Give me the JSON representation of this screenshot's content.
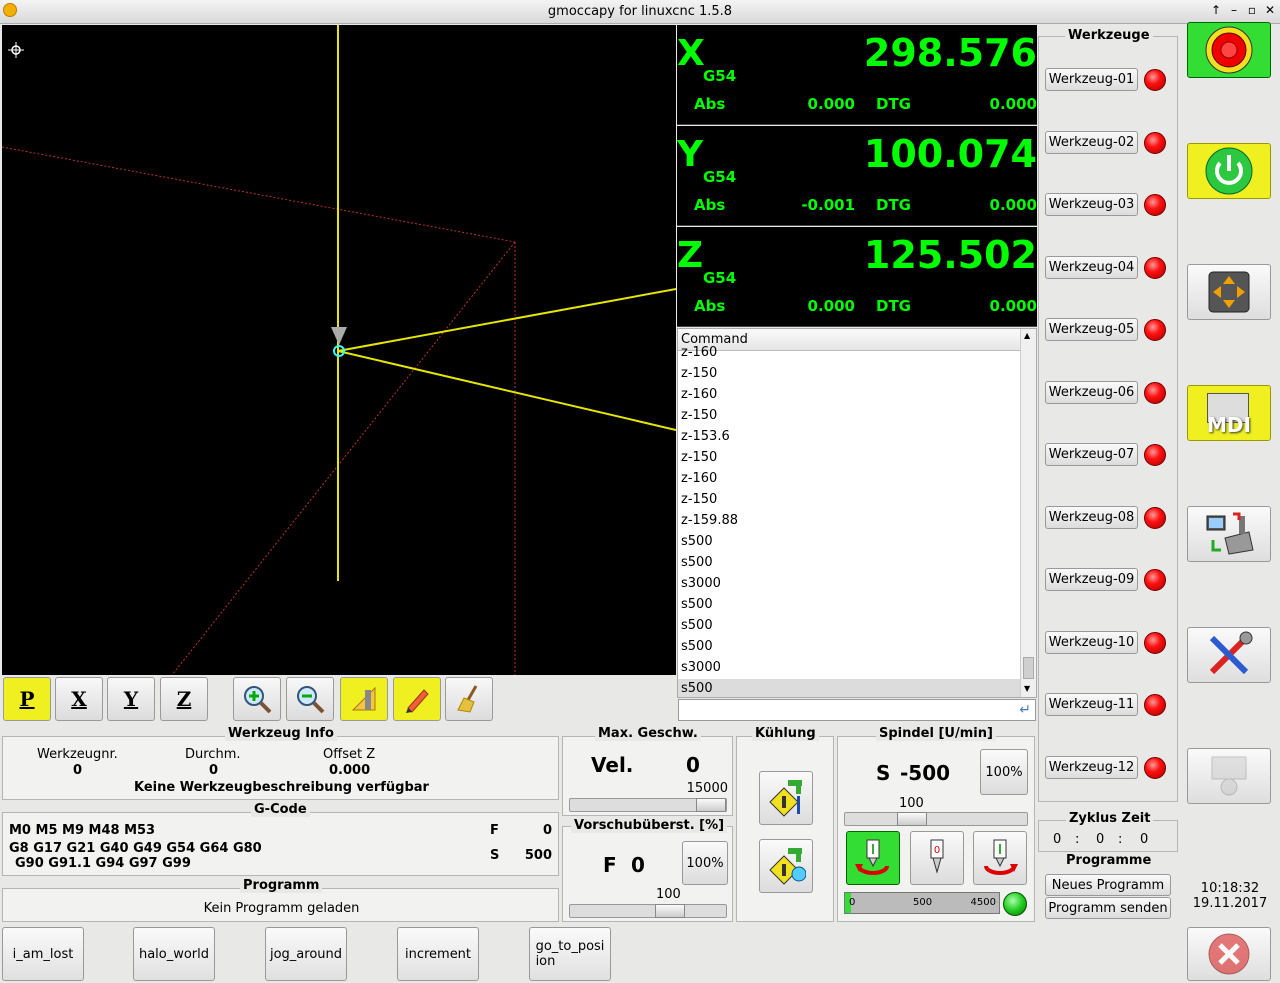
{
  "window": {
    "title": "gmoccapy for linuxcnc  1.5.8"
  },
  "dro": [
    {
      "axis": "X",
      "coord": "G54",
      "value": "298.576",
      "abs_label": "Abs",
      "abs": "0.000",
      "dtg_label": "DTG",
      "dtg": "0.000"
    },
    {
      "axis": "Y",
      "coord": "G54",
      "value": "100.074",
      "abs_label": "Abs",
      "abs": "-0.001",
      "dtg_label": "DTG",
      "dtg": "0.000"
    },
    {
      "axis": "Z",
      "coord": "G54",
      "value": "125.502",
      "abs_label": "Abs",
      "abs": "0.000",
      "dtg_label": "DTG",
      "dtg": "0.000"
    }
  ],
  "command_list": {
    "header": "Command",
    "rows": [
      "z-160",
      "z-150",
      "z-160",
      "z-150",
      "z-153.6",
      "z-150",
      "z-160",
      "z-150",
      "z-159.88",
      "s500",
      "s500",
      "s3000",
      "s500",
      "s500",
      "s500",
      "s3000",
      "s500"
    ]
  },
  "view_toolbar": {
    "p": "P",
    "x": "X",
    "y": "Y",
    "z": "Z"
  },
  "tool_info": {
    "title": "Werkzeug Info",
    "nr_label": "Werkzeugnr.",
    "nr": "0",
    "diam_label": "Durchm.",
    "diam": "0",
    "offset_label": "Offset Z",
    "offset": "0.000",
    "desc": "Keine Werkzeugbeschreibung verfügbar"
  },
  "gcode": {
    "title": "G-Code",
    "line1": "M0 M5 M9 M48 M53",
    "line2": "G8 G17 G21 G40 G49 G54 G64 G80",
    "line3": "G90 G91.1 G94 G97 G99",
    "f_label": "F",
    "f": "0",
    "s_label": "S",
    "s": "500"
  },
  "program": {
    "title": "Programm",
    "text": "Kein Programm geladen"
  },
  "max_vel": {
    "title": "Max. Geschw.",
    "label": "Vel.",
    "value": "0",
    "max": "15000",
    "slider_fraction": 1.0
  },
  "feed_override": {
    "title": "Vorschubüberst. [%]",
    "label": "F",
    "value": "0",
    "button": "100%",
    "scale": "100"
  },
  "coolant": {
    "title": "Kühlung"
  },
  "spindle": {
    "title": "Spindel [U/min]",
    "label": "S",
    "value": "-500",
    "button": "100%",
    "scale": "100",
    "bar_min": "0",
    "bar_mid": "500",
    "bar_max": "4500",
    "bar_fraction": 0.04
  },
  "tools": {
    "title": "Werkzeuge",
    "items": [
      "Werkzeug-01",
      "Werkzeug-02",
      "Werkzeug-03",
      "Werkzeug-04",
      "Werkzeug-05",
      "Werkzeug-06",
      "Werkzeug-07",
      "Werkzeug-08",
      "Werkzeug-09",
      "Werkzeug-10",
      "Werkzeug-11",
      "Werkzeug-12"
    ]
  },
  "cycle": {
    "title": "Zyklus Zeit",
    "h": "0",
    "m": "0",
    "s": "0",
    "sep": ":"
  },
  "programs": {
    "title": "Programme",
    "new": "Neues Programm",
    "send": "Programm senden"
  },
  "clock": {
    "time": "10:18:32",
    "date": "19.11.2017"
  },
  "side": {
    "mdi": "MDI"
  },
  "macros": [
    "i_am_lost",
    "halo_world",
    "jog_around",
    "increment",
    "go_to_posi\nion"
  ],
  "colors": {
    "dro_green": "#00ff00",
    "yellow": "#f0f020",
    "green_button": "#33dd33"
  }
}
